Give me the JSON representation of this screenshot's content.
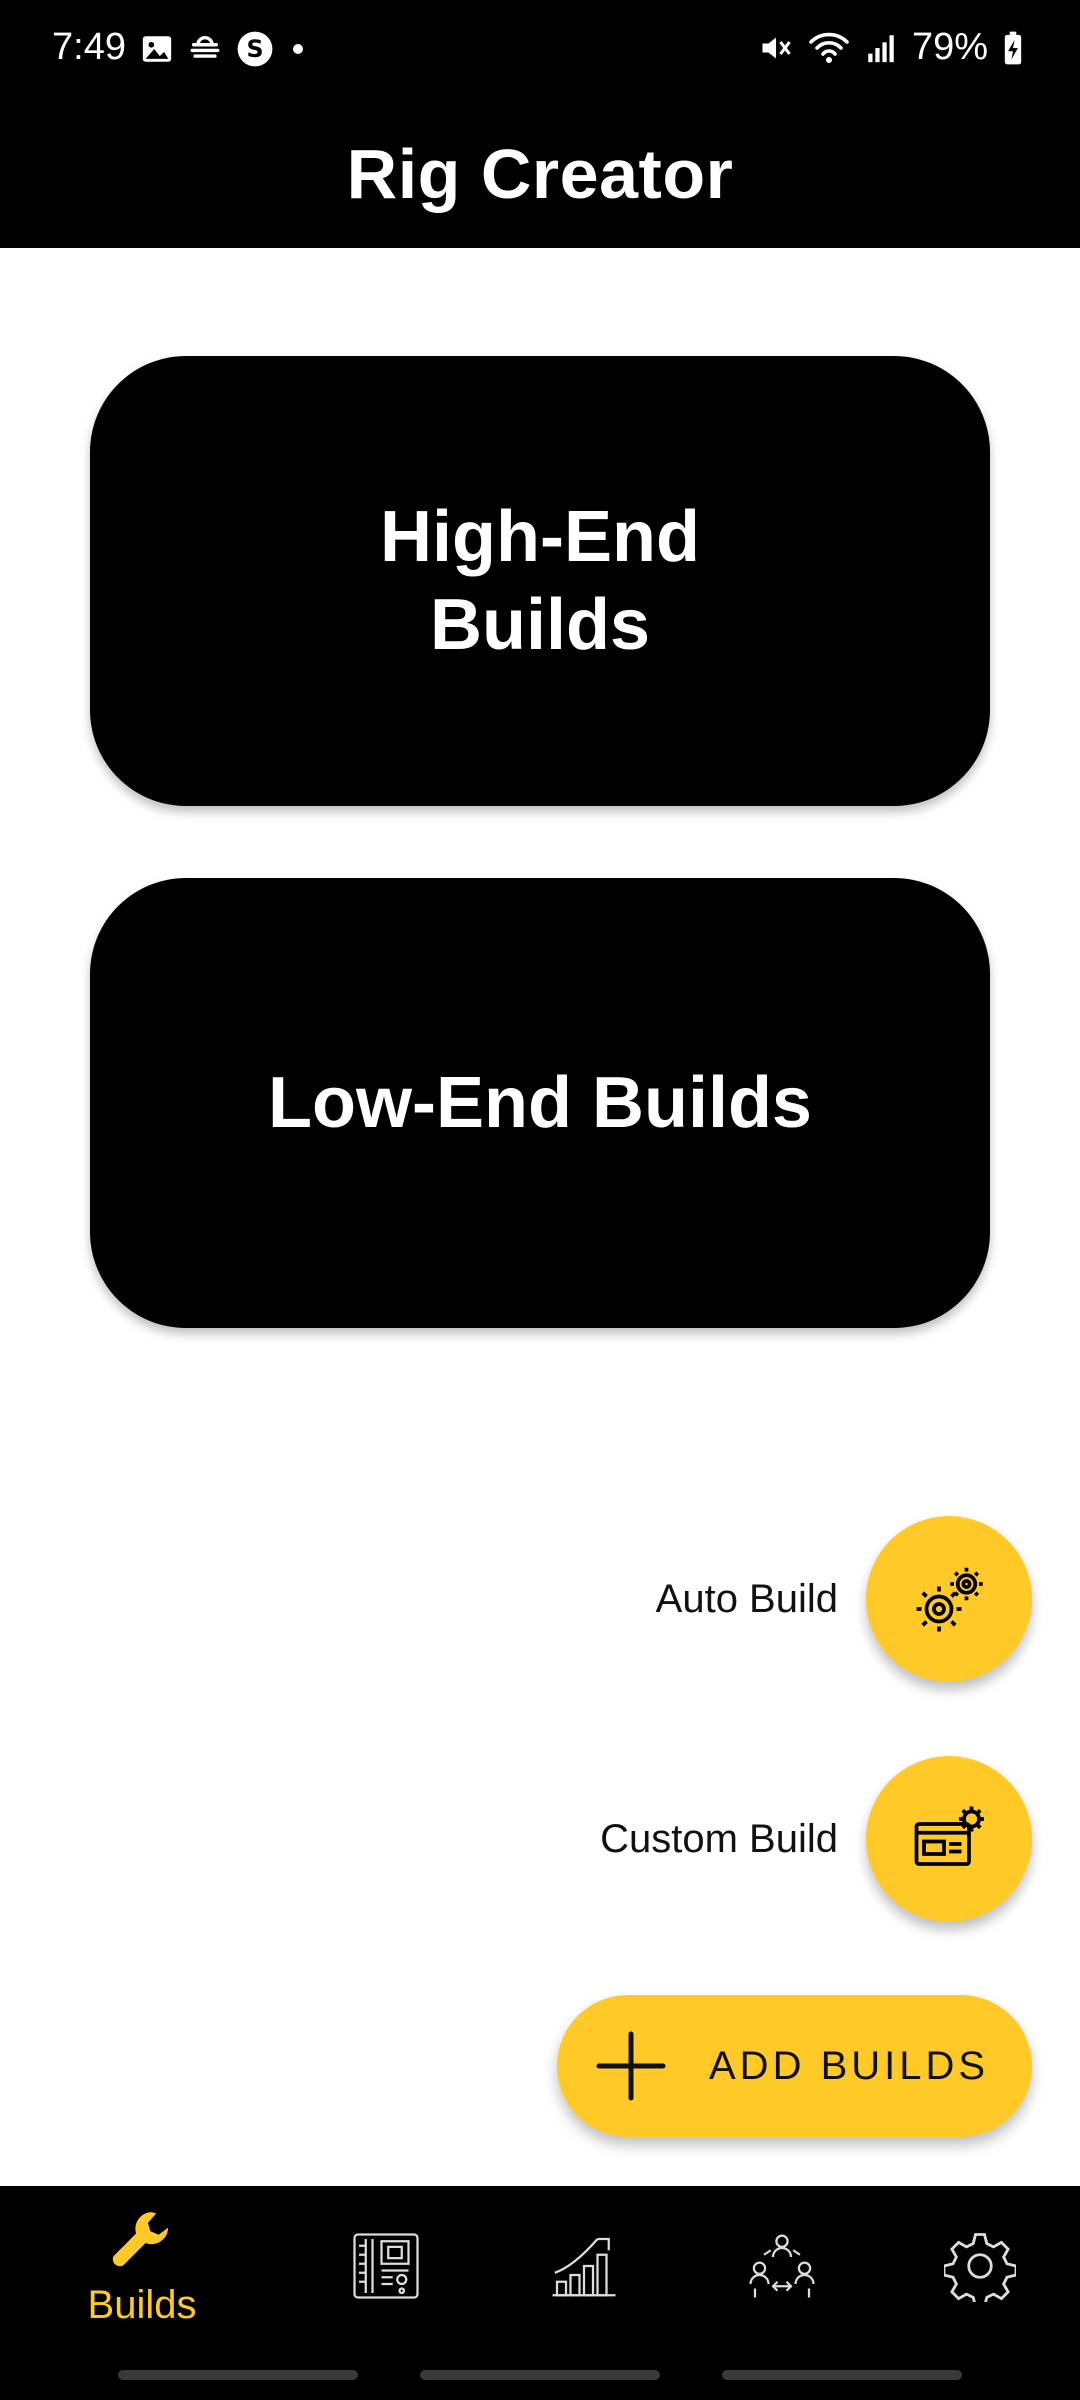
{
  "status_bar": {
    "time": "7:49",
    "battery": "79%"
  },
  "app": {
    "title": "Rig Creator"
  },
  "cards": {
    "high_end": "High-End\nBuilds",
    "low_end": "Low-End Builds"
  },
  "speed_dial": {
    "auto_build_label": "Auto Build",
    "custom_build_label": "Custom Build",
    "add_builds_label": "ADD BUILDS"
  },
  "bottom_nav": {
    "builds_label": "Builds",
    "active": "builds",
    "icons": [
      "wrench-icon",
      "components-icon",
      "chart-icon",
      "community-icon",
      "gear-icon"
    ]
  },
  "colors": {
    "accent": "#ffca28",
    "bar_bg": "#000000",
    "card_bg": "#000000"
  }
}
